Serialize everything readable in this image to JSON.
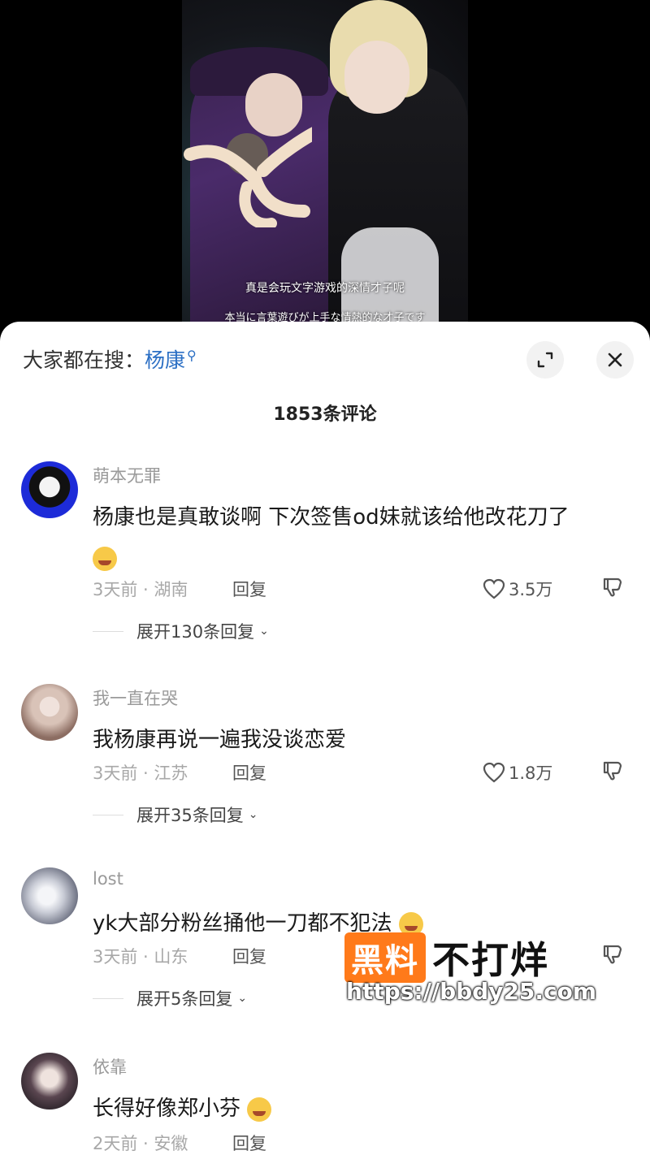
{
  "video": {
    "subtitle_zh": "真是会玩文字游戏的深情才子呢",
    "subtitle_ja": "本当に言葉遊びが上手な情熱的な才子です"
  },
  "sheet": {
    "search_label": "大家都在搜：",
    "search_term": "杨康",
    "comment_count": "1853条评论"
  },
  "comments": [
    {
      "username": "萌本无罪",
      "text": "杨康也是真敢谈啊 下次签售od妹就该给他改花刀了",
      "meta": "3天前 · 湖南",
      "reply_label": "回复",
      "likes": "3.5万",
      "expand": "展开130条回复",
      "avatar_color": "#1d2bd8"
    },
    {
      "username": "我一直在哭",
      "text": "我杨康再说一遍我没谈恋爱",
      "meta": "3天前 · 江苏",
      "reply_label": "回复",
      "likes": "1.8万",
      "expand": "展开35条回复",
      "avatar_color": "#b89a8a"
    },
    {
      "username": "lost",
      "text": "yk大部分粉丝捅他一刀都不犯法",
      "meta": "3天前 · 山东",
      "reply_label": "回复",
      "likes": "",
      "expand": "展开5条回复",
      "avatar_color": "#c9ccd6"
    },
    {
      "username": "依靠",
      "text": "长得好像郑小芬",
      "meta": "2天前 · 安徽",
      "reply_label": "回复",
      "likes": "",
      "expand": "",
      "avatar_color": "#5a4650"
    }
  ],
  "watermark": {
    "badge": "黑料",
    "text": "不打烊",
    "url": "https://bbdy25.com"
  },
  "icons": {
    "search": "search-icon",
    "expand": "expand-icon",
    "close": "close-icon",
    "like": "heart-icon",
    "dislike": "dislike-icon",
    "chevron": "chevron-down-icon"
  }
}
